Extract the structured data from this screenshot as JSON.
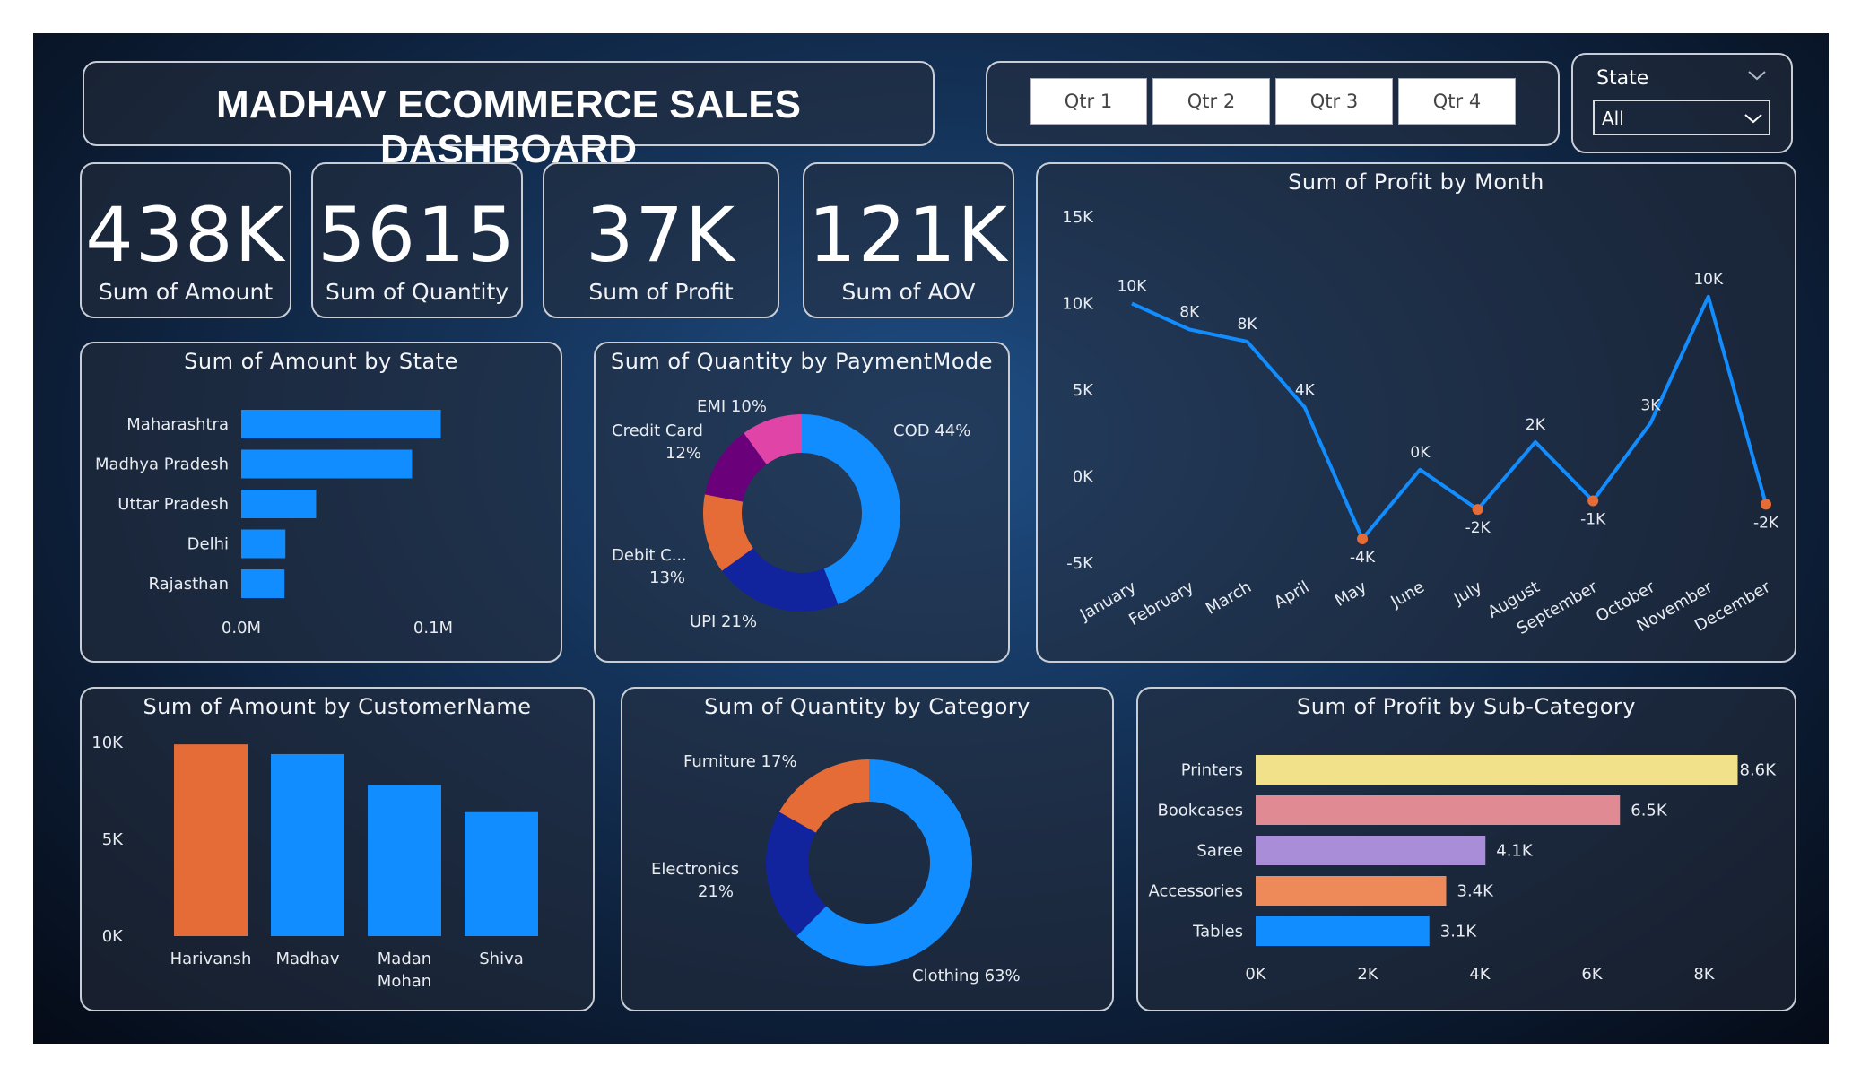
{
  "header": {
    "title": "MADHAV ECOMMERCE SALES DASHBOARD"
  },
  "quarters": [
    "Qtr 1",
    "Qtr 2",
    "Qtr 3",
    "Qtr 4"
  ],
  "state_filter": {
    "label": "State",
    "value": "All"
  },
  "kpis": [
    {
      "value": "438K",
      "label": "Sum of Amount"
    },
    {
      "value": "5615",
      "label": "Sum of Quantity"
    },
    {
      "value": "37K",
      "label": "Sum of Profit"
    },
    {
      "value": "121K",
      "label": "Sum of AOV"
    }
  ],
  "colors": {
    "blue": "#118dff",
    "orange": "#e66c37",
    "navy": "#12239e",
    "purple": "#6b007b",
    "pink": "#e044a7",
    "yellow": "#f2e18b",
    "rose": "#e08b93",
    "lavender": "#a98dd9",
    "salmon": "#ee8a5a"
  },
  "chart_data": [
    {
      "type": "bar",
      "title": "Sum of Amount by State",
      "orientation": "horizontal",
      "categories": [
        "Maharashtra",
        "Madhya Pradesh",
        "Uttar Pradesh",
        "Delhi",
        "Rajasthan"
      ],
      "values": [
        104000,
        89000,
        39000,
        23000,
        22500
      ],
      "xticks": [
        "0.0M",
        "0.1M"
      ],
      "xlim": [
        0,
        100000
      ]
    },
    {
      "type": "pie",
      "title": "Sum of Quantity by PaymentMode",
      "donut": true,
      "categories": [
        "COD",
        "UPI",
        "Debit Card",
        "Credit Card",
        "EMI"
      ],
      "values": [
        44,
        21,
        13,
        12,
        10
      ],
      "labels": [
        "COD 44%",
        "UPI 21%",
        "Debit C...",
        "13%",
        "Credit Card",
        "12%",
        "EMI 10%"
      ]
    },
    {
      "type": "line",
      "title": "Sum of Profit by Month",
      "x": [
        "January",
        "February",
        "March",
        "April",
        "May",
        "June",
        "July",
        "August",
        "September",
        "October",
        "November",
        "December"
      ],
      "values": [
        10000,
        8500,
        7800,
        4000,
        -3600,
        400,
        -1900,
        2000,
        -1400,
        3100,
        10400,
        -1600
      ],
      "data_labels": [
        "10K",
        "8K",
        "8K",
        "4K",
        "-4K",
        "0K",
        "-2K",
        "2K",
        "-1K",
        "3K",
        "10K",
        "-2K"
      ],
      "yticks": [
        "15K",
        "10K",
        "5K",
        "0K",
        "-5K"
      ],
      "ylim": [
        -5000,
        15000
      ]
    },
    {
      "type": "bar",
      "title": "Sum of Amount by CustomerName",
      "categories": [
        "Harivansh",
        "Madhav",
        "Madan Mohan",
        "Shiva"
      ],
      "values": [
        9900,
        9400,
        7800,
        6400
      ],
      "yticks": [
        "10K",
        "5K",
        "0K"
      ],
      "ylim": [
        0,
        10000
      ]
    },
    {
      "type": "pie",
      "title": "Sum of Quantity by Category",
      "donut": true,
      "categories": [
        "Clothing",
        "Electronics",
        "Furniture"
      ],
      "values": [
        63,
        21,
        17
      ],
      "labels": [
        "Clothing 63%",
        "Electronics",
        "21%",
        "Furniture 17%"
      ]
    },
    {
      "type": "bar",
      "title": "Sum of Profit by Sub-Category",
      "orientation": "horizontal",
      "categories": [
        "Printers",
        "Bookcases",
        "Saree",
        "Accessories",
        "Tables"
      ],
      "values": [
        8600,
        6500,
        4100,
        3400,
        3100
      ],
      "data_labels": [
        "8.6K",
        "6.5K",
        "4.1K",
        "3.4K",
        "3.1K"
      ],
      "xticks": [
        "0K",
        "2K",
        "4K",
        "6K",
        "8K"
      ],
      "xlim": [
        0,
        8000
      ]
    }
  ]
}
